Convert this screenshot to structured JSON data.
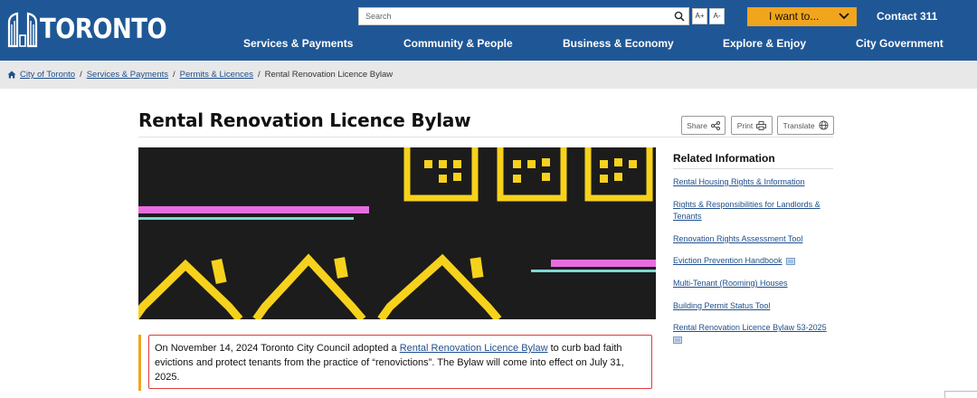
{
  "header": {
    "logo_text": "TORONTO",
    "search_placeholder": "Search",
    "font_increase": "A+",
    "font_decrease": "A-",
    "i_want_label": "I want to...",
    "contact_label": "Contact 311",
    "nav": [
      "Services & Payments",
      "Community & People",
      "Business & Economy",
      "Explore & Enjoy",
      "City Government"
    ]
  },
  "breadcrumb": {
    "items": [
      "City of Toronto",
      "Services & Payments",
      "Permits & Licences"
    ],
    "current": "Rental Renovation Licence Bylaw"
  },
  "page": {
    "title": "Rental Renovation Licence Bylaw",
    "share": "Share",
    "print": "Print",
    "translate": "Translate"
  },
  "notice": {
    "before": "On November 14, 2024 Toronto City Council adopted a ",
    "link": "Rental Renovation Licence Bylaw",
    "after": " to curb bad faith evictions and protect tenants from the practice of “renovictions”. The Bylaw will come into effect on July 31, 2025."
  },
  "sidebar": {
    "heading": "Related Information",
    "links": [
      "Rental Housing Rights & Information",
      "Rights & Responsibilities for Landlords & Tenants",
      "Renovation Rights Assessment Tool",
      "Eviction Prevention Handbook",
      "Multi-Tenant (Rooming) Houses",
      "Building Permit Status Tool",
      "Rental Renovation Licence Bylaw 53-2025"
    ]
  },
  "colors": {
    "header_blue": "#1f5796",
    "accent_orange": "#f1a51c",
    "link_blue": "#1f4f8c",
    "notice_border": "#e23a3a",
    "hero_yellow": "#f7d21c",
    "hero_pink": "#e86ce0",
    "hero_teal": "#7fd6d6"
  },
  "icons": [
    "city-hall-logo-icon",
    "search-icon",
    "chevron-down-icon",
    "home-icon",
    "share-icon",
    "print-icon",
    "globe-icon",
    "document-icon"
  ]
}
